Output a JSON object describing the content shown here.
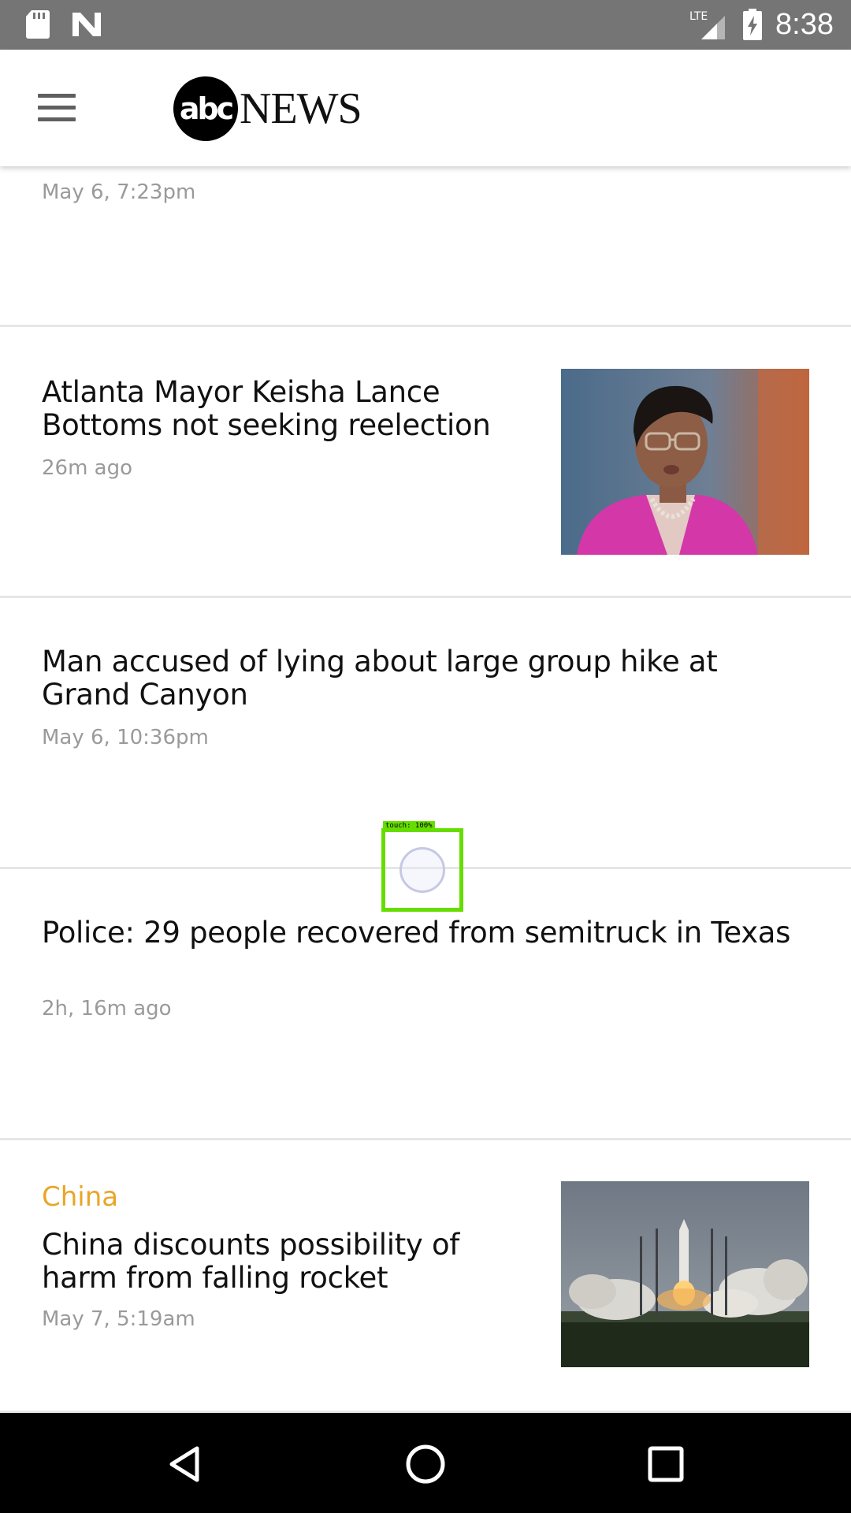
{
  "status_bar": {
    "time": "8:38",
    "network": "LTE",
    "icons": [
      "sd-card-icon",
      "n-notification-icon",
      "lte-signal-icon",
      "battery-charging-icon"
    ]
  },
  "header": {
    "logo_abc": "abc",
    "logo_news": "NEWS",
    "menu_icon": "hamburger-menu-icon"
  },
  "feed": {
    "partial_card": {
      "timestamp": "May 6, 7:23pm"
    },
    "cards": [
      {
        "headline": "Atlanta Mayor Keisha Lance Bottoms not seeking reelection",
        "timestamp": "26m ago",
        "has_image": true,
        "image_subject": "woman-portrait-image"
      },
      {
        "headline": "Man accused of lying about large group hike at Grand Canyon",
        "timestamp": "May 6, 10:36pm",
        "has_image": false
      },
      {
        "headline": "Police: 29 people recovered from semitruck in Texas",
        "timestamp": "2h, 16m ago",
        "has_image": false
      },
      {
        "kicker": "China",
        "headline": "China discounts possibility of harm from falling rocket",
        "timestamp": "May 7, 5:19am",
        "has_image": true,
        "image_subject": "rocket-launch-image"
      }
    ]
  },
  "touch_overlay": {
    "label": "touch: 100%"
  },
  "colors": {
    "status_bar_bg": "#757575",
    "kicker": "#e9a626",
    "headline": "#111111",
    "timestamp": "#9a9a9a",
    "divider": "#e6e6e6",
    "touch_highlight": "#66dd00"
  },
  "nav_bar": {
    "buttons": [
      "back-icon",
      "home-icon",
      "recent-apps-icon"
    ]
  }
}
